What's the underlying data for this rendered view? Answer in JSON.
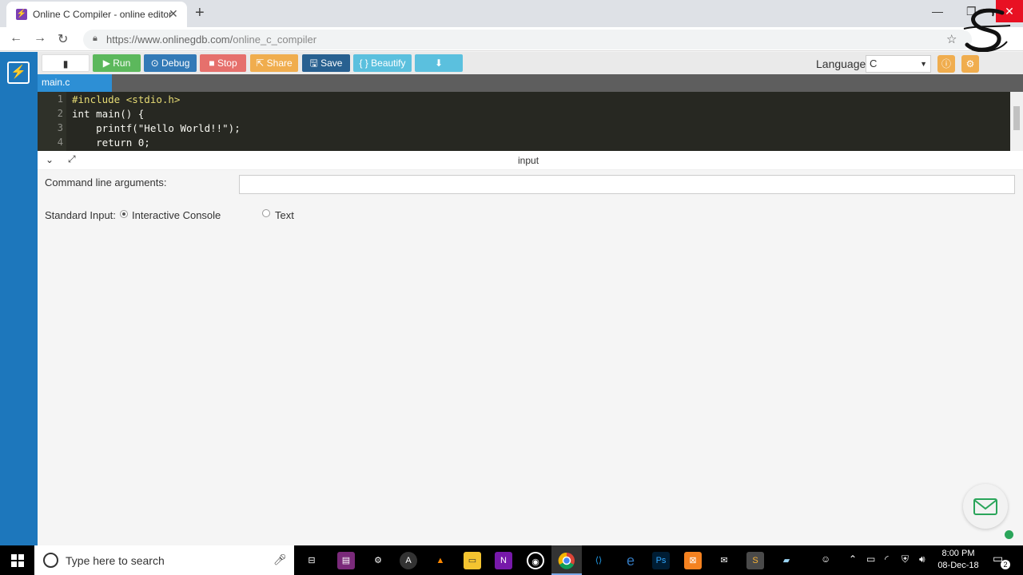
{
  "browser": {
    "tab_title": "Online C Compiler - online editor",
    "url_prefix": "https://www.onlinegdb.com/",
    "url_path": "online_c_compiler"
  },
  "toolbar": {
    "run": "Run",
    "debug": "Debug",
    "stop": "Stop",
    "share": "Share",
    "save": "Save",
    "beautify": "{ } Beautify",
    "language_label": "Language",
    "language_value": "C"
  },
  "editor": {
    "file_tab": "main.c",
    "lines": [
      {
        "n": "1",
        "text": "#include <stdio.h>"
      },
      {
        "n": "2",
        "text": "int main() {"
      },
      {
        "n": "3",
        "text": "    printf(\"Hello World!!\");"
      },
      {
        "n": "4",
        "text": "    return 0;"
      }
    ]
  },
  "io": {
    "panel_title": "input",
    "args_label": "Command line arguments:",
    "stdin_label": "Standard Input:",
    "option_interactive": "Interactive Console",
    "option_text": "Text"
  },
  "taskbar": {
    "search_placeholder": "Type here to search",
    "time": "8:00 PM",
    "date": "08-Dec-18",
    "notifications": "2"
  },
  "colors": {
    "sidebar": "#1d77bc",
    "run": "#5cb85c",
    "debug": "#337ab7",
    "stop": "#d9534f",
    "share": "#f0ad4e",
    "save": "#286090",
    "beautify": "#5bc0de",
    "download": "#5bc0de"
  }
}
